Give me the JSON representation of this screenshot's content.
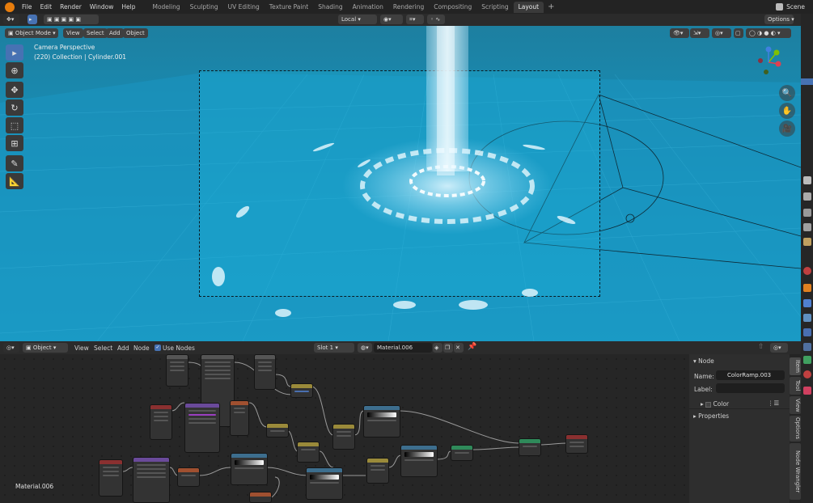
{
  "topbar": {
    "menus": [
      "File",
      "Edit",
      "Render",
      "Window",
      "Help"
    ],
    "workspaces": [
      "Modeling",
      "Sculpting",
      "UV Editing",
      "Texture Paint",
      "Shading",
      "Animation",
      "Rendering",
      "Compositing",
      "Scripting",
      "Layout"
    ],
    "active_workspace": "Layout",
    "scene_label": "Scene"
  },
  "viewport": {
    "transform_orientation": "Local",
    "options_label": "Options",
    "mode": "Object Mode",
    "menus": [
      "View",
      "Select",
      "Add",
      "Object"
    ],
    "info_line1": "Camera Perspective",
    "info_line2": "(220) Collection | Cylinder.001"
  },
  "node_editor": {
    "editor_type": "Object",
    "menus": [
      "View",
      "Select",
      "Add",
      "Node"
    ],
    "use_nodes_label": "Use Nodes",
    "slot": "Slot 1",
    "material": "Material.006",
    "material_label": "Material.006"
  },
  "sidebar": {
    "panel_title": "Node",
    "name_label": "Name:",
    "name_value": "ColorRamp.003",
    "label_label": "Label:",
    "label_value": "",
    "color_label": "Color",
    "properties_label": "Properties",
    "tabs": [
      "Item",
      "Tool",
      "View",
      "Options",
      "Node Wrangler"
    ]
  },
  "colors": {
    "accent": "#4772b3",
    "viewport_sea": "#1796c0"
  }
}
